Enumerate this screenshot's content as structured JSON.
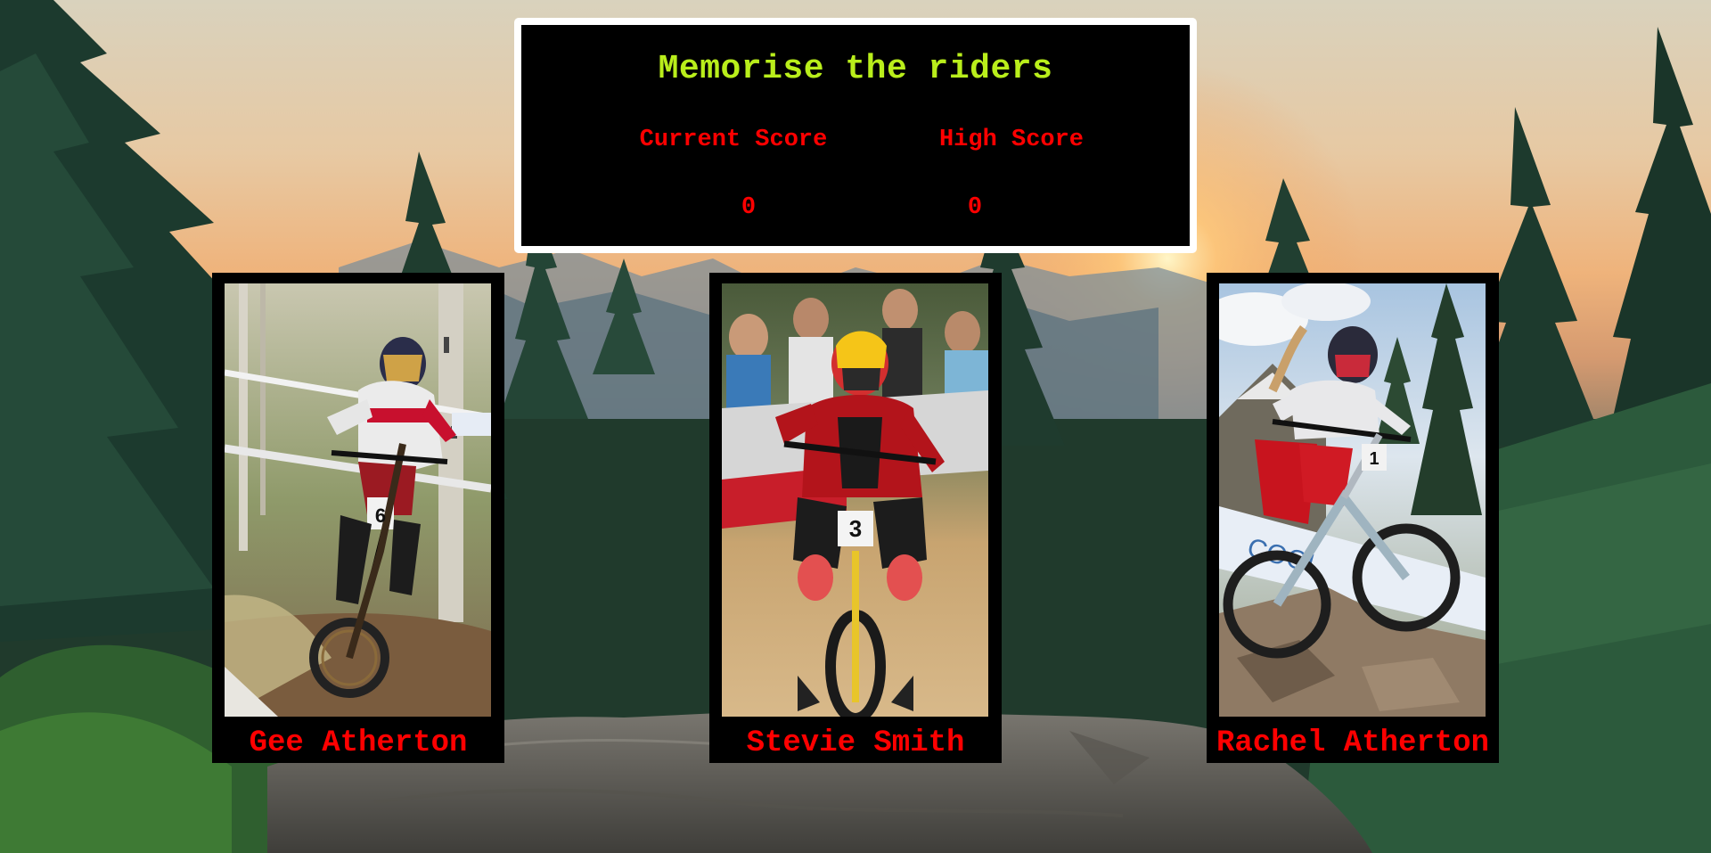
{
  "game": {
    "title": "Memorise the riders",
    "current_score_label": "Current Score",
    "high_score_label": "High Score",
    "current_score": "0",
    "high_score": "0"
  },
  "riders": [
    {
      "name": "Gee Atherton",
      "photo_icon": "rider-photo-gee-atherton",
      "plate_number": "6"
    },
    {
      "name": "Stevie Smith",
      "photo_icon": "rider-photo-stevie-smith",
      "plate_number": "3"
    },
    {
      "name": "Rachel Atherton",
      "photo_icon": "rider-photo-rachel-atherton",
      "plate_number": "1"
    }
  ],
  "colors": {
    "title": "#b9ee1b",
    "score_text": "#ff0000",
    "rider_name": "#ff0000",
    "panel_background": "#000000",
    "panel_border": "#ffffff"
  }
}
